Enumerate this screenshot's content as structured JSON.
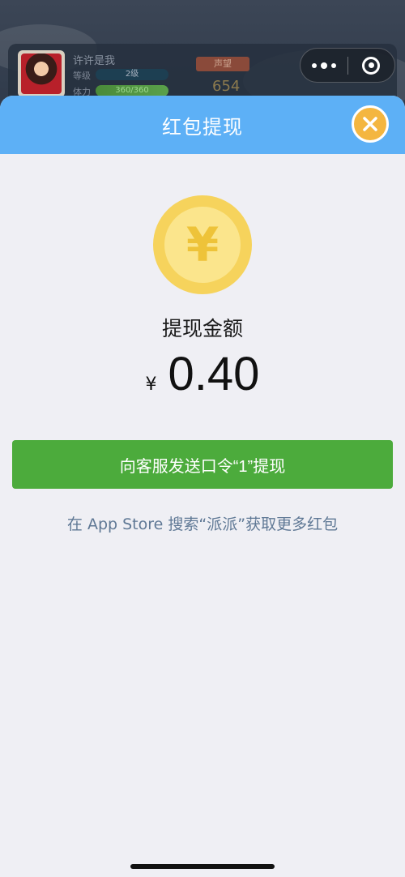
{
  "background": {
    "player_name": "许许是我",
    "level_label": "等级",
    "level_value": "2级",
    "stamina_label": "体力",
    "stamina_value": "360/360",
    "reputation_label": "声望",
    "reputation_value": "654"
  },
  "capsule": {
    "more_icon": "more-dots-icon",
    "close_icon": "exit-ring-icon"
  },
  "modal": {
    "title": "红包提现",
    "close_icon": "close-icon",
    "coin_symbol": "¥",
    "amount_label": "提现金额",
    "currency": "¥",
    "amount": "0.40",
    "withdraw_button": "向客服发送口令“1”提现",
    "hint": "在 App Store 搜索“派派”获取更多红包"
  },
  "colors": {
    "header": "#5db0f6",
    "button": "#4cab3c",
    "close": "#f4b640",
    "hint": "#5f7895",
    "coin": "#f6d35c"
  }
}
